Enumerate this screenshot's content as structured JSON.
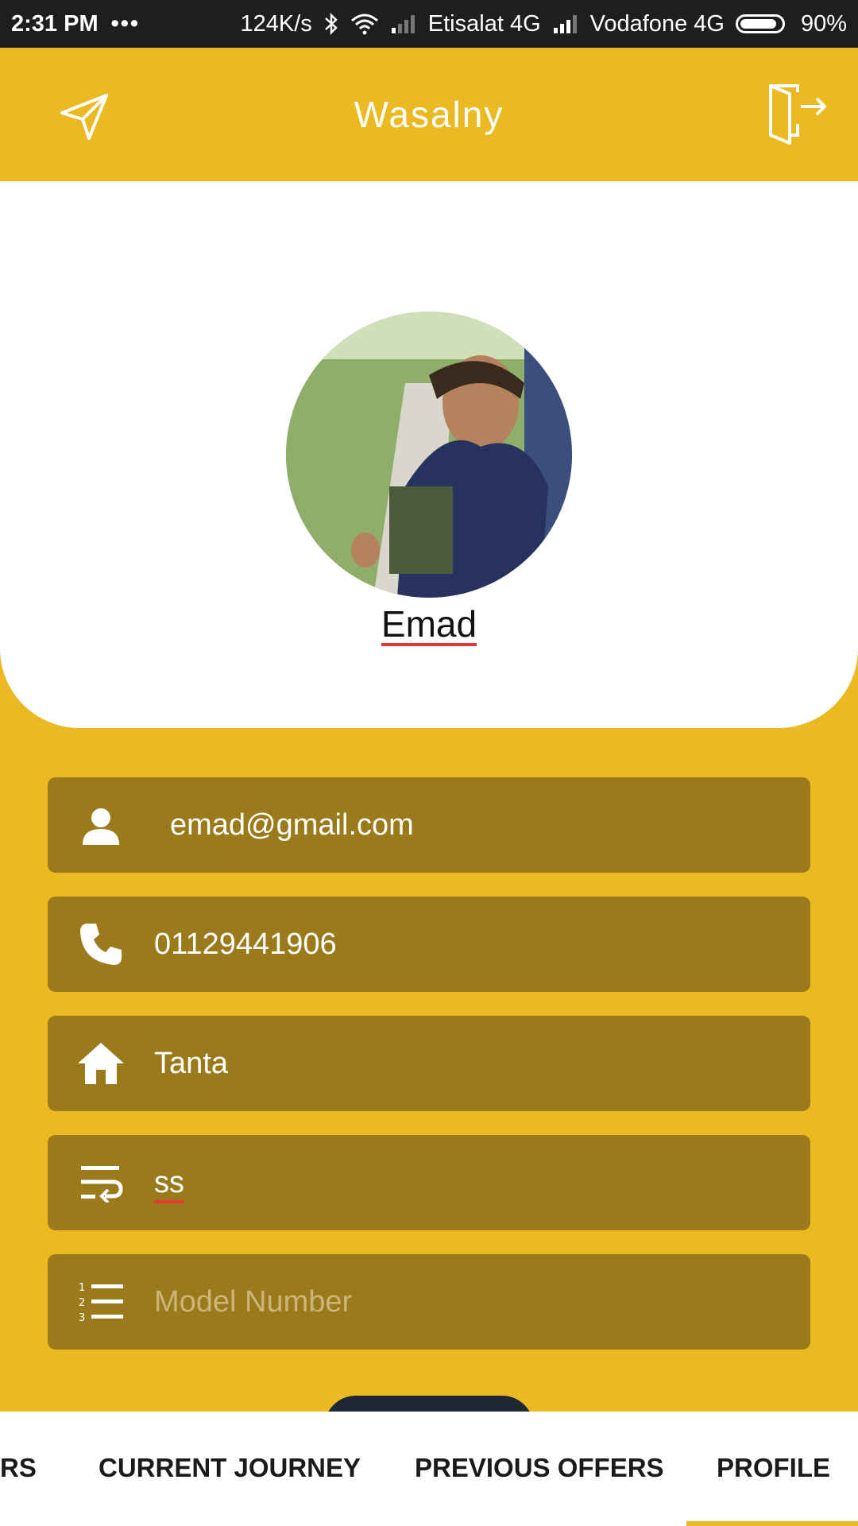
{
  "status_bar": {
    "time": "2:31 PM",
    "dots": "•••",
    "speed": "124K/s",
    "carrier1": "Etisalat 4G",
    "carrier2": "Vodafone 4G",
    "battery": "90%",
    "battery_level": 0.9
  },
  "app_bar": {
    "title": "Wasalny",
    "left_icon": "send-icon",
    "right_icon": "logout-icon"
  },
  "profile": {
    "name": "Emad"
  },
  "fields": [
    {
      "icon": "person-icon",
      "value": "emad@gmail.com"
    },
    {
      "icon": "phone-icon",
      "value": "01129441906"
    },
    {
      "icon": "home-icon",
      "value": "Tanta"
    },
    {
      "icon": "wrap-text-icon",
      "value": "ss"
    },
    {
      "icon": "numbered-list-icon",
      "placeholder": "Model Number"
    }
  ],
  "tabs": [
    {
      "label": "RS"
    },
    {
      "label": "CURRENT JOURNEY"
    },
    {
      "label": "PREVIOUS OFFERS"
    },
    {
      "label": "PROFILE",
      "selected": true
    }
  ],
  "colors": {
    "brand": "#EBB921",
    "field_bg": "#9A7A1A",
    "accent_underline": "#e53935"
  }
}
